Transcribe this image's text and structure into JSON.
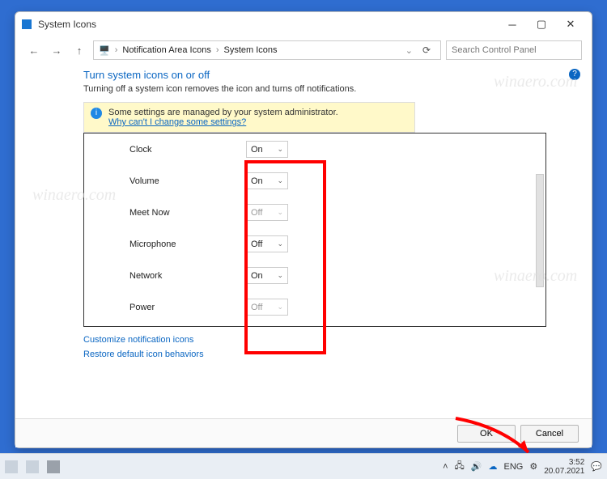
{
  "colors": {
    "accent": "#0a66c2",
    "highlight_border": "#ff0000",
    "desktop": "#2f6dd0"
  },
  "window": {
    "title": "System Icons",
    "breadcrumb": [
      "Notification Area Icons",
      "System Icons"
    ],
    "search_placeholder": "Search Control Panel"
  },
  "page": {
    "heading": "Turn system icons on or off",
    "subhead": "Turning off a system icon removes the icon and turns off notifications.",
    "banner_text": "Some settings are managed by your system administrator.",
    "banner_link": "Why can't I change some settings?",
    "dropdown_options": [
      "On",
      "Off"
    ],
    "rows": [
      {
        "name": "Clock",
        "value": "On",
        "enabled": true
      },
      {
        "name": "Volume",
        "value": "On",
        "enabled": true
      },
      {
        "name": "Meet Now",
        "value": "Off",
        "enabled": false
      },
      {
        "name": "Microphone",
        "value": "Off",
        "enabled": true
      },
      {
        "name": "Network",
        "value": "On",
        "enabled": true
      },
      {
        "name": "Power",
        "value": "Off",
        "enabled": false
      }
    ],
    "customize_link": "Customize notification icons",
    "restore_link": "Restore default icon behaviors"
  },
  "footer": {
    "ok": "OK",
    "cancel": "Cancel"
  },
  "taskbar": {
    "lang": "ENG",
    "time": "3:52",
    "date": "20.07.2021"
  },
  "watermark": "winaero.com"
}
